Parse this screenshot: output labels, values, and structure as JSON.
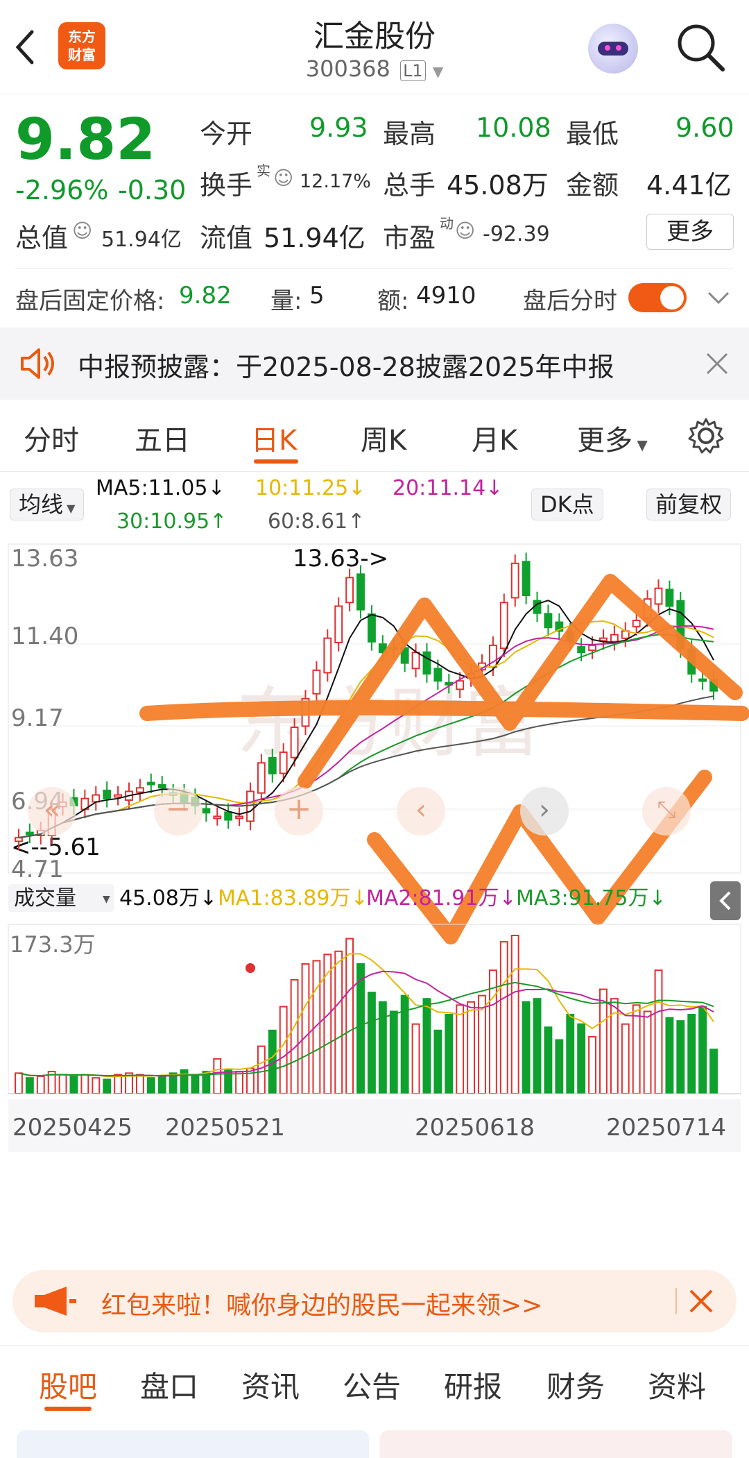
{
  "header": {
    "logo_line1": "东方",
    "logo_line2": "财富",
    "title": "汇金股份",
    "code": "300368",
    "level": "L1"
  },
  "quote": {
    "price": "9.82",
    "change_pct": "-2.96%",
    "change": "-0.30",
    "open_label": "今开",
    "open": "9.93",
    "high_label": "最高",
    "high": "10.08",
    "low_label": "最低",
    "low": "9.60",
    "turnover_label": "换手",
    "turnover_sup": "实",
    "turnover": "12.17%",
    "volume_label": "总手",
    "volume": "45.08万",
    "amount_label": "金额",
    "amount": "4.41亿",
    "mcap_label": "总值",
    "mcap": "51.94亿",
    "float_label": "流值",
    "float": "51.94亿",
    "pe_label": "市盈",
    "pe_sup": "动",
    "pe": "-92.39",
    "more": "更多",
    "after_price_label": "盘后固定价格:",
    "after_price": "9.82",
    "after_vol_label": "量:",
    "after_vol": "5",
    "after_amt_label": "额:",
    "after_amt": "4910",
    "after_toggle_label": "盘后分时"
  },
  "notice": {
    "text": "中报预披露：于2025-08-28披露2025年中报"
  },
  "tabs": [
    "分时",
    "五日",
    "日K",
    "周K",
    "月K",
    "更多"
  ],
  "ma": {
    "select": "均线",
    "ma5": "MA5:11.05↓",
    "ma10": "10:11.25↓",
    "ma20": "20:11.14↓",
    "ma30": "30:10.95↑",
    "ma60": "60:8.61↑",
    "dk": "DK点",
    "fq": "前复权"
  },
  "kline": {
    "y_labels": [
      "13.63",
      "11.40",
      "9.17",
      "6.94",
      "4.71"
    ],
    "max_label": "13.63->",
    "min_label": "<--5.61",
    "watermark": "东方财富"
  },
  "volume": {
    "select": "成交量",
    "vol": "45.08万↓",
    "ma1": "MA1:83.89万↓",
    "ma2": "MA2:81.91万↓",
    "ma3": "MA3:91.75万↓",
    "y_max": "173.3万"
  },
  "dates": [
    "20250425",
    "20250521",
    "20250618",
    "20250714"
  ],
  "banner": {
    "text": "红包来啦！喊你身边的股民一起来领>>"
  },
  "bottom_tabs": [
    "股吧",
    "盘口",
    "资讯",
    "公告",
    "研报",
    "财务",
    "资料"
  ],
  "colors": {
    "up": "#e0302f",
    "down": "#0ea12e",
    "accent": "#e85a12",
    "ma5": "#111111",
    "ma10": "#e6b800",
    "ma20": "#c2229f",
    "ma30": "#1a9a2a",
    "ma60": "#555555"
  }
}
